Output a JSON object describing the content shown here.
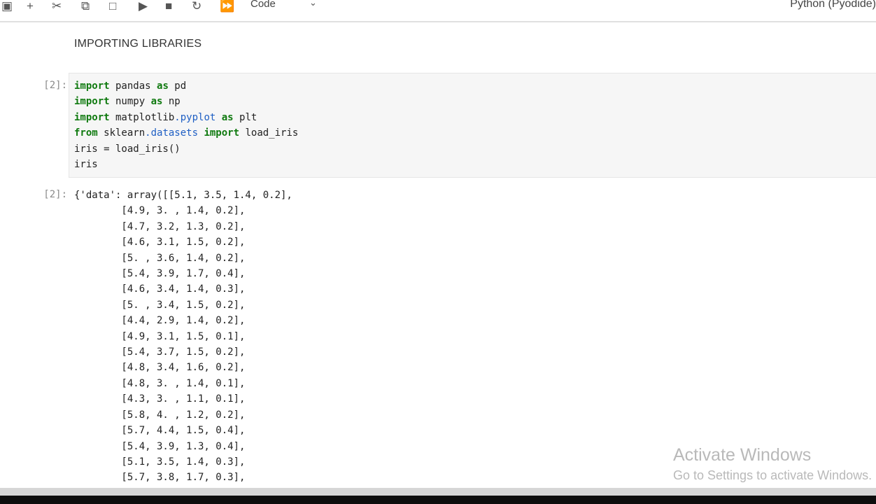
{
  "toolbar": {
    "icons": [
      "save-icon",
      "add-icon",
      "cut-icon",
      "copy-icon",
      "paste-icon",
      "run-icon",
      "stop-icon",
      "restart-icon",
      "fast-forward-icon"
    ],
    "cell_type": "Code",
    "kernel": "Python (Pyodide)"
  },
  "markdown_cell": {
    "text": "IMPORTING LIBRARIES"
  },
  "code_cell": {
    "prompt": "[2]:",
    "lines": [
      [
        {
          "t": "import",
          "k": "kw"
        },
        {
          "t": " pandas "
        },
        {
          "t": "as",
          "k": "kw"
        },
        {
          "t": " pd"
        }
      ],
      [
        {
          "t": "import",
          "k": "kw"
        },
        {
          "t": " numpy "
        },
        {
          "t": "as",
          "k": "kw"
        },
        {
          "t": " np"
        }
      ],
      [
        {
          "t": "import",
          "k": "kw"
        },
        {
          "t": " matplotlib"
        },
        {
          "t": ".pyplot",
          "k": "md"
        },
        {
          "t": " "
        },
        {
          "t": "as",
          "k": "kw"
        },
        {
          "t": " plt"
        }
      ],
      [
        {
          "t": "from",
          "k": "kw"
        },
        {
          "t": " sklearn"
        },
        {
          "t": ".datasets",
          "k": "md"
        },
        {
          "t": " "
        },
        {
          "t": "import",
          "k": "kw"
        },
        {
          "t": " load_iris"
        }
      ],
      [
        {
          "t": "iris = load_iris()"
        }
      ],
      [
        {
          "t": "iris"
        }
      ]
    ]
  },
  "output_cell": {
    "prompt": "[2]:",
    "lines": [
      "{'data': array([[5.1, 3.5, 1.4, 0.2],",
      "        [4.9, 3. , 1.4, 0.2],",
      "        [4.7, 3.2, 1.3, 0.2],",
      "        [4.6, 3.1, 1.5, 0.2],",
      "        [5. , 3.6, 1.4, 0.2],",
      "        [5.4, 3.9, 1.7, 0.4],",
      "        [4.6, 3.4, 1.4, 0.3],",
      "        [5. , 3.4, 1.5, 0.2],",
      "        [4.4, 2.9, 1.4, 0.2],",
      "        [4.9, 3.1, 1.5, 0.1],",
      "        [5.4, 3.7, 1.5, 0.2],",
      "        [4.8, 3.4, 1.6, 0.2],",
      "        [4.8, 3. , 1.4, 0.1],",
      "        [4.3, 3. , 1.1, 0.1],",
      "        [5.8, 4. , 1.2, 0.2],",
      "        [5.7, 4.4, 1.5, 0.4],",
      "        [5.4, 3.9, 1.3, 0.4],",
      "        [5.1, 3.5, 1.4, 0.3],",
      "        [5.7, 3.8, 1.7, 0.3],"
    ]
  },
  "watermark": {
    "title": "Activate Windows",
    "subtitle": "Go to Settings to activate Windows."
  }
}
